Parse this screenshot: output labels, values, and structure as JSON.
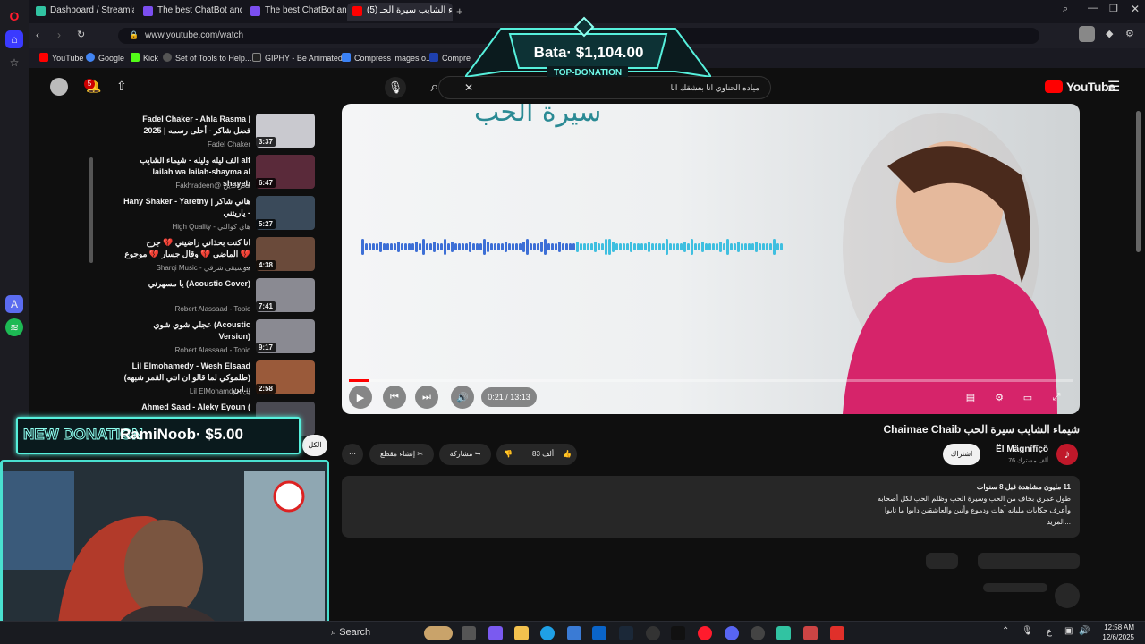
{
  "browser": {
    "tabs": [
      {
        "label": "Dashboard / Streamlabs",
        "color": "#31c3a2"
      },
      {
        "label": "The best ChatBot and Wi",
        "color": "#7b4ef0"
      },
      {
        "label": "The best ChatBot and Wi",
        "color": "#7b4ef0"
      },
      {
        "label": "(5) شيماء الشايب سيرة الحـ",
        "color": "#ff0000"
      }
    ],
    "url": "www.youtube.com/watch",
    "bookmarks": [
      "YouTube",
      "Google",
      "Kick",
      "Set of Tools to Help...",
      "GIPHY - Be Animated",
      "Compress images o...",
      "Compre"
    ]
  },
  "overlay": {
    "top_donation_amount": "Bata· $1,104.00",
    "top_donation_label": "TOP-DONATION",
    "new_donation_label": "NEW DONATION",
    "new_donation_text": "RamiNoob· $5.00"
  },
  "youtube": {
    "logo": "YouTube",
    "notif_count": "5",
    "search_value": "مياده الحناوي انا بعشقك انا",
    "recommendations": [
      {
        "title": "Fadel Chaker - Ahla Rasma | 2025 | فضل شاكر - أحلى رسمه",
        "channel": "Fadel Chaker",
        "duration": "3:37",
        "color": "#c9c9cf"
      },
      {
        "title": "الف ليله وليله - شيماء الشايب alf lailah wa lailah-shayma al shayeb",
        "channel": "Fakhradeen@ فخرالدين",
        "duration": "6:47",
        "color": "#5a2a3a"
      },
      {
        "title": "Hany Shaker - Yaretny | هاني شاكر - ياريتني",
        "channel": "High Quality - هاي كوالتي",
        "duration": "5:27",
        "color": "#3a4a5a"
      },
      {
        "title": "انا كنت بحذاني راضيني 💔 جرح الماضي 💔 وقال جسار 💔 موجوع 💔 ...",
        "channel": "Sharqi Music - موسيقى شرقي",
        "duration": "4:38",
        "color": "#6a4a3a"
      },
      {
        "title": "يا مسهرني (Acoustic Cover)",
        "channel": "Robert Alassaad - Topic",
        "duration": "7:41",
        "color": "#8a8a92"
      },
      {
        "title": "عجلي شوي شوي (Acoustic Version)",
        "channel": "Robert Alassaad - Topic",
        "duration": "9:17",
        "color": "#8a8a92"
      },
      {
        "title": "Lil Elmohamedy - Wesh Elsaad (طلموكي لما قالو ان انتي القمر شبهه) ابن...",
        "channel": "Lil ElMohamdy - لِل",
        "duration": "2:58",
        "color": "#9a5a3a"
      },
      {
        "title": "Ahmed Saad - Aleky Eyoun (",
        "channel": "",
        "duration": "",
        "color": "#4a4a52"
      }
    ],
    "video_heading": "سيرة الحب",
    "time": "0:21 / 13:13",
    "progress": 0.027,
    "video_title": "شيماء الشايب سيرة الحب Chaimae Chaib",
    "channel_name": "Ël Mägnîfîçö",
    "subscribers": "76 ألف مشترك",
    "subscribe_label": "اشتراك",
    "like_count": "83 ألف",
    "share_label": "مشاركة",
    "clip_label": "إنشاء مقطع",
    "all_label": "الكل",
    "description_stats": "11 مليون مشاهدة  قبل 8 سنوات",
    "description_line1": "طول عمري بخاف من الحب وسيرة الحب وظلم الحب لكل أصحابه",
    "description_line2": "وأعرف حكايات مليانه آهات ودموع وأنين والعاشقين دابوا ما تابوا",
    "description_more": "...المزيد"
  },
  "taskbar": {
    "search_label": "Search",
    "time": "12:58 AM",
    "date": "12/6/2025",
    "lang": "ع"
  }
}
